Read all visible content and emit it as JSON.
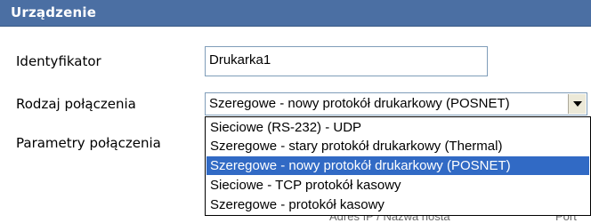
{
  "header": {
    "title": "Urządzenie"
  },
  "form": {
    "identifier_label": "Identyfikator",
    "identifier_value": "Drukarka1",
    "connection_type_label": "Rodzaj połączenia",
    "connection_type_value": "Szeregowe - nowy protokół drukarkowy (POSNET)",
    "connection_params_label": "Parametry połączenia"
  },
  "dropdown": {
    "items": [
      {
        "label": "Sieciowe (RS-232) - UDP",
        "selected": false
      },
      {
        "label": "Szeregowe - stary protokół drukarkowy (Thermal)",
        "selected": false
      },
      {
        "label": "Szeregowe - nowy protokół drukarkowy (POSNET)",
        "selected": true
      },
      {
        "label": "Sieciowe - TCP protokół kasowy",
        "selected": false
      },
      {
        "label": "Szeregowe - protokół kasowy",
        "selected": false
      }
    ]
  },
  "partially_hidden": {
    "text_1": "Adres IP / Nazwa hosta",
    "text_2": "Port"
  },
  "colors": {
    "header_bg": "#4b6fa3",
    "selection_bg": "#316ac5"
  }
}
